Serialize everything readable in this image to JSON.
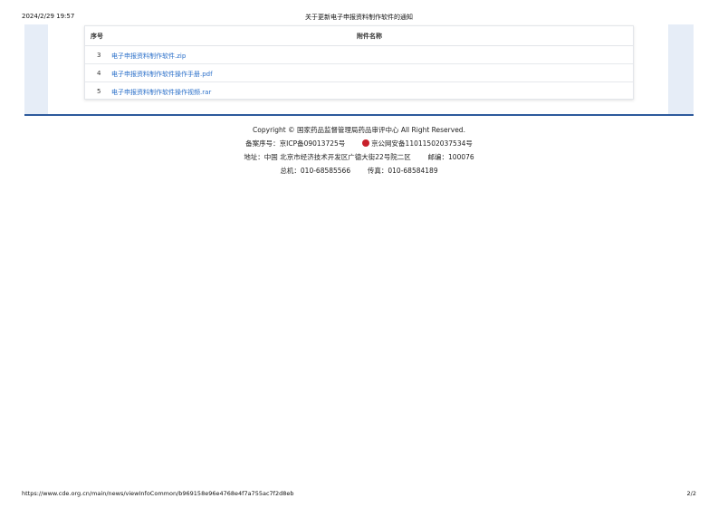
{
  "print_header": {
    "date": "2024/2/29 19:57",
    "title": "关于更新电子申报资料制作软件的通知"
  },
  "attachments": {
    "col_seq": "序号",
    "col_name": "附件名称",
    "rows": [
      {
        "seq": "3",
        "name": "电子申报资料制作软件.zip"
      },
      {
        "seq": "4",
        "name": "电子申报资料制作软件操作手册.pdf"
      },
      {
        "seq": "5",
        "name": "电子申报资料制作软件操作视频.rar"
      }
    ]
  },
  "footer": {
    "copyright": "Copyright © 国家药品监督管理局药品审评中心   All Right Reserved.",
    "icp": "备案序号：京ICP备09013725号",
    "police": "京公网安备11011502037534号",
    "address": "地址：中国 北京市经济技术开发区广德大街22号院二区",
    "postal": "邮编：100076",
    "phone": "总机：010-68585566",
    "fax": "传真：010-68584189"
  },
  "print_footer": {
    "url": "https://www.cde.org.cn/main/news/viewInfoCommon/b969158e96e4768e4f7a755ac7f2d8eb",
    "pages": "2/2"
  },
  "colors": {
    "link": "#2a6fc9",
    "accent_line": "#2d5a9c",
    "side_band": "#e6edf7"
  }
}
